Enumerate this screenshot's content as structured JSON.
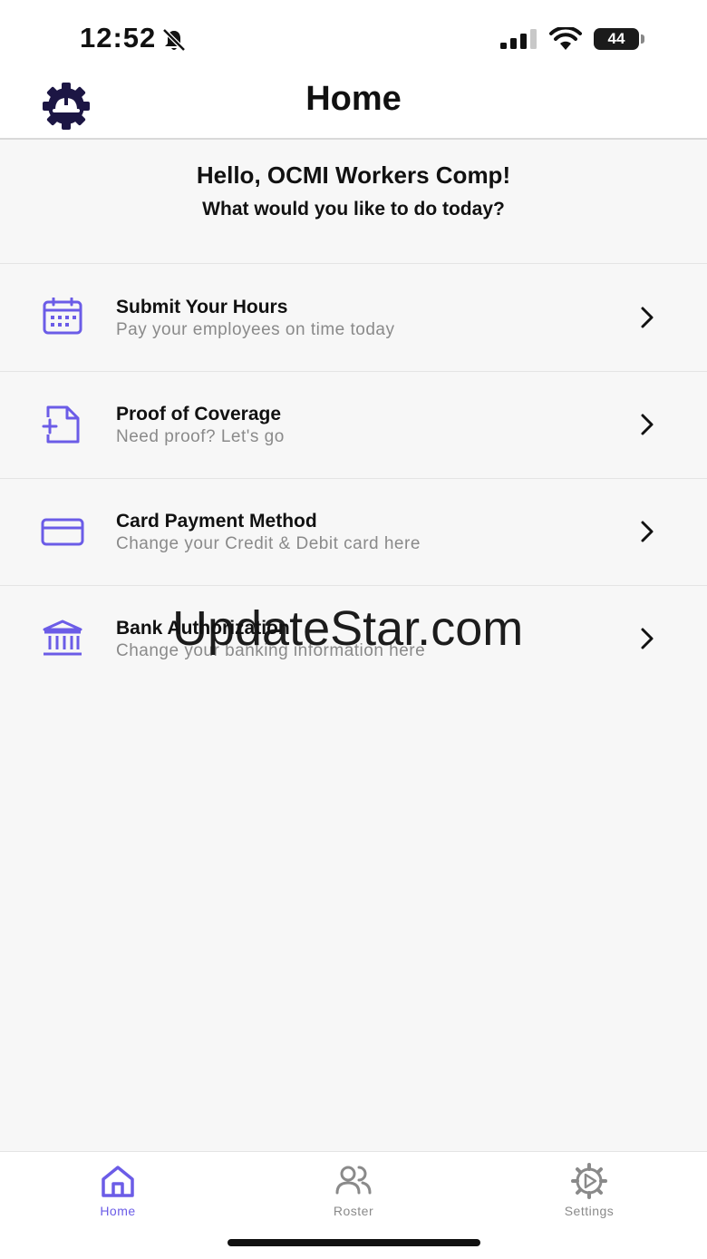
{
  "status_bar": {
    "time": "12:52",
    "battery": "44"
  },
  "header": {
    "title": "Home"
  },
  "greeting": {
    "title": "Hello, OCMI Workers Comp!",
    "subtitle": "What would you like to do today?"
  },
  "menu": [
    {
      "title": "Submit Your Hours",
      "subtitle": "Pay your employees on time today",
      "icon": "calendar-icon"
    },
    {
      "title": "Proof of Coverage",
      "subtitle": "Need proof? Let's go",
      "icon": "file-add-icon"
    },
    {
      "title": "Card Payment Method",
      "subtitle": "Change your Credit & Debit card here",
      "icon": "credit-card-icon"
    },
    {
      "title": "Bank Authorization",
      "subtitle": "Change your banking information here",
      "icon": "bank-icon"
    }
  ],
  "watermark": "UpdateStar.com",
  "tabs": [
    {
      "label": "Home",
      "icon": "home-icon",
      "active": true
    },
    {
      "label": "Roster",
      "icon": "users-icon",
      "active": false
    },
    {
      "label": "Settings",
      "icon": "settings-icon",
      "active": false
    }
  ],
  "colors": {
    "accent": "#6b5ce7",
    "inactive": "#8a8a8a",
    "logo": "#1c1644"
  }
}
